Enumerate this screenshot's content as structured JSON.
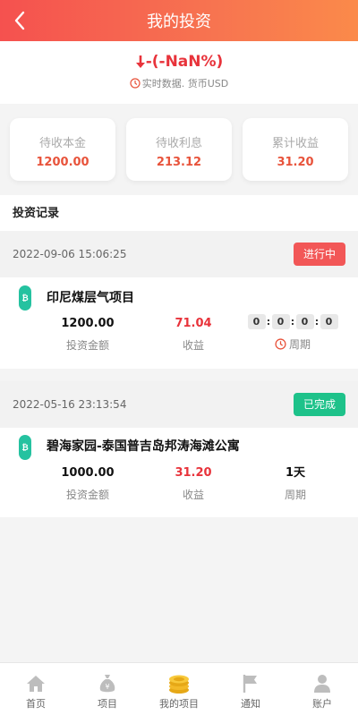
{
  "header": {
    "title": "我的投资"
  },
  "summary": {
    "change": "-(-NaN%)",
    "note": "实时数据. 货币USD"
  },
  "stats": [
    {
      "label": "待收本金",
      "value": "1200.00"
    },
    {
      "label": "待收利息",
      "value": "213.12"
    },
    {
      "label": "累计收益",
      "value": "31.20"
    }
  ],
  "section": {
    "title": "投资记录"
  },
  "records": [
    {
      "date": "2022-09-06 15:06:25",
      "status": "进行中",
      "coin_symbol": "₿",
      "name": "印尼煤层气项目",
      "amount": "1200.00",
      "amount_label": "投资金额",
      "profit": "71.04",
      "profit_label": "收益",
      "timer": [
        "0",
        "0",
        "0",
        "0"
      ],
      "period_label": "周期"
    },
    {
      "date": "2022-05-16 23:13:54",
      "status": "已完成",
      "coin_symbol": "₿",
      "name": "碧海家园-泰国普吉岛邦涛海滩公寓",
      "amount": "1000.00",
      "amount_label": "投资金额",
      "profit": "31.20",
      "profit_label": "收益",
      "period": "1天",
      "period_label": "周期"
    }
  ],
  "tabbar": [
    {
      "label": "首页",
      "icon": "home-icon"
    },
    {
      "label": "项目",
      "icon": "money-bag-icon"
    },
    {
      "label": "我的项目",
      "icon": "coin-stack-icon"
    },
    {
      "label": "通知",
      "icon": "flag-icon"
    },
    {
      "label": "账户",
      "icon": "user-icon"
    }
  ],
  "colors": {
    "accent": "#f5514f",
    "profit_red": "#e8333b",
    "status_running": "#f25757",
    "status_done": "#1ec28a"
  }
}
